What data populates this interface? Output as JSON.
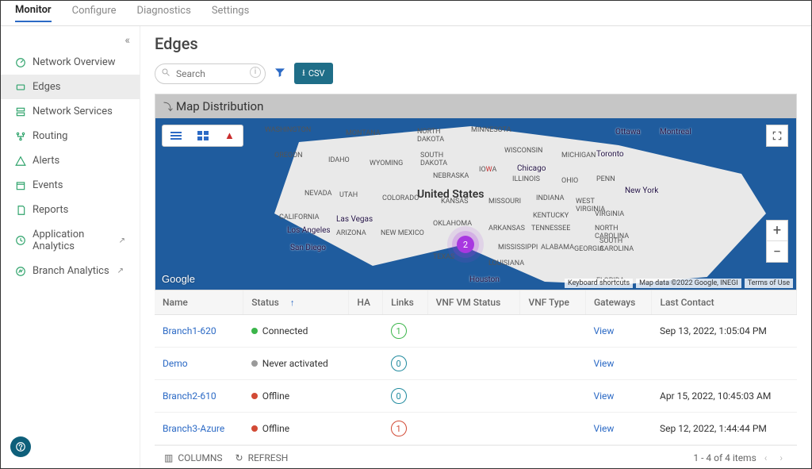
{
  "topTabs": [
    "Monitor",
    "Configure",
    "Diagnostics",
    "Settings"
  ],
  "topActive": 0,
  "sidebar": {
    "items": [
      {
        "label": "Network Overview",
        "icon": "dashboard-icon"
      },
      {
        "label": "Edges",
        "icon": "edge-icon"
      },
      {
        "label": "Network Services",
        "icon": "services-icon"
      },
      {
        "label": "Routing",
        "icon": "routing-icon"
      },
      {
        "label": "Alerts",
        "icon": "alerts-icon"
      },
      {
        "label": "Events",
        "icon": "events-icon"
      },
      {
        "label": "Reports",
        "icon": "reports-icon"
      },
      {
        "label": "Application Analytics",
        "icon": "analytics-icon",
        "external": true
      },
      {
        "label": "Branch Analytics",
        "icon": "branch-icon",
        "external": true
      }
    ],
    "active": 1
  },
  "page": {
    "title": "Edges"
  },
  "toolbar": {
    "search_placeholder": "Search",
    "csv_label": "CSV"
  },
  "map": {
    "header": "Map Distribution",
    "country_label": "United States",
    "pin_count": "2",
    "google_logo": "Google",
    "attrib": [
      "Keyboard shortcuts",
      "Map data ©2022 Google, INEGI",
      "Terms of Use"
    ],
    "states": [
      "WASHINGTON",
      "MONTANA",
      "NORTH DAKOTA",
      "MINNESOTA",
      "OREGON",
      "IDAHO",
      "WYOMING",
      "SOUTH DAKOTA",
      "WISCONSIN",
      "MICHIGAN",
      "NEBRASKA",
      "IOWA",
      "ILLINOIS",
      "OHIO",
      "PENN",
      "NEVADA",
      "UTAH",
      "COLORADO",
      "KANSAS",
      "MISSOURI",
      "INDIANA",
      "WEST VIRGINIA",
      "CALIFORNIA",
      "KENTUCKY",
      "VIRGINIA",
      "OKLAHOMA",
      "ARKANSAS",
      "TENNESSEE",
      "NORTH CAROLINA",
      "ARIZONA",
      "NEW MEXICO",
      "TEXAS",
      "MISSISSIPPI",
      "ALABAMA",
      "GEORGIA",
      "SOUTH CAROLINA",
      "LOUISIANA",
      "FLORIDA"
    ],
    "cities": [
      "Ottawa",
      "Montreal",
      "Toronto",
      "Chicago",
      "New York",
      "Las Vegas",
      "Los Angeles",
      "San Diego",
      "Houston"
    ]
  },
  "table": {
    "columns": [
      "Name",
      "Status",
      "HA",
      "Links",
      "VNF VM Status",
      "VNF Type",
      "Gateways",
      "Last Contact"
    ],
    "sort_col": 1,
    "rows": [
      {
        "name": "Branch1-620",
        "status_label": "Connected",
        "status_color": "green",
        "links": "1",
        "links_color": "green",
        "gateways": "View",
        "last_contact": "Sep 13, 2022, 1:05:04 PM"
      },
      {
        "name": "Demo",
        "status_label": "Never activated",
        "status_color": "grey",
        "links": "0",
        "links_color": "teal",
        "gateways": "View",
        "last_contact": ""
      },
      {
        "name": "Branch2-610",
        "status_label": "Offline",
        "status_color": "red",
        "links": "0",
        "links_color": "teal",
        "gateways": "View",
        "last_contact": "Apr 15, 2022, 10:45:03 AM"
      },
      {
        "name": "Branch3-Azure",
        "status_label": "Offline",
        "status_color": "red",
        "links": "1",
        "links_color": "red",
        "gateways": "View",
        "last_contact": "Sep 12, 2022, 1:44:44 PM"
      }
    ],
    "footer": {
      "columns_label": "COLUMNS",
      "refresh_label": "REFRESH",
      "range_label": "1 - 4 of 4 items"
    }
  }
}
